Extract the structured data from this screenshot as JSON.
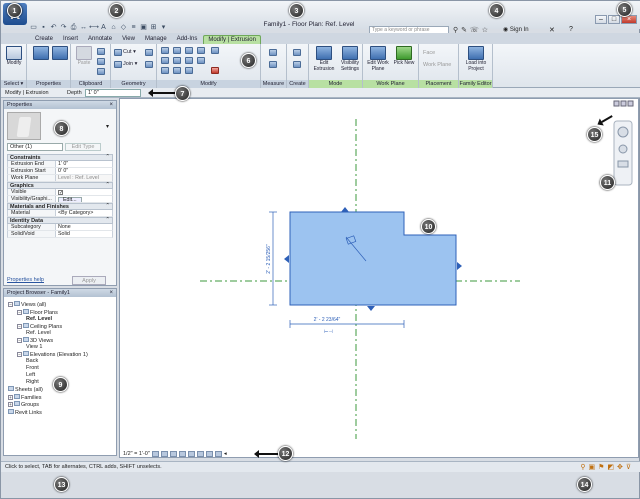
{
  "window": {
    "title": "Family1 - Floor Plan: Ref. Level",
    "search_placeholder": "Type a keyword or phrase",
    "signin": "Sign In",
    "app_letter": "R"
  },
  "tabs": [
    "Create",
    "Insert",
    "Annotate",
    "View",
    "Manage",
    "Add-Ins",
    "Modify | Extrusion"
  ],
  "ribbon": {
    "panels": [
      "Select ▾",
      "Properties",
      "Clipboard",
      "Geometry",
      "Modify",
      "Measure",
      "Create",
      "Mode",
      "Work Plane",
      "Placement",
      "Family Editor"
    ],
    "modify_label": "Modify",
    "paste_label": "Paste",
    "cut_label": "Cut ▾",
    "join_label": "Join ▾",
    "mode_buttons": [
      "Edit Extrusion",
      "Visibility Settings"
    ],
    "workplane_buttons": [
      "Edit Work Plane",
      "Pick New"
    ],
    "placement": [
      "Face",
      "Work Plane"
    ],
    "load_label": "Load into Project"
  },
  "options_bar": {
    "mode": "Modify | Extrusion",
    "depth_label": "Depth",
    "depth_value": "1'  0\""
  },
  "properties": {
    "title": "Properties",
    "type_selector": "Other (1)",
    "edit_type": "Edit Type",
    "groups": [
      {
        "name": "Constraints",
        "rows": [
          [
            "Extrusion End",
            "1'  0\""
          ],
          [
            "Extrusion Start",
            "0'  0\""
          ],
          [
            "Work Plane",
            "Level : Ref. Level"
          ]
        ]
      },
      {
        "name": "Graphics",
        "rows": [
          [
            "Visible",
            "✓"
          ],
          [
            "Visibility/Graphi...",
            "Edit..."
          ]
        ]
      },
      {
        "name": "Materials and Finishes",
        "rows": [
          [
            "Material",
            "<By Category>"
          ]
        ]
      },
      {
        "name": "Identity Data",
        "rows": [
          [
            "Subcategory",
            "None"
          ],
          [
            "Solid/Void",
            "Solid"
          ]
        ]
      }
    ],
    "help": "Properties help",
    "apply": "Apply"
  },
  "browser": {
    "title": "Project Browser - Family1",
    "items": [
      {
        "label": "Views (all)",
        "level": 0,
        "exp": "−"
      },
      {
        "label": "Floor Plans",
        "level": 1,
        "exp": "−"
      },
      {
        "label": "Ref. Level",
        "level": 2,
        "bold": true
      },
      {
        "label": "Ceiling Plans",
        "level": 1,
        "exp": "−"
      },
      {
        "label": "Ref. Level",
        "level": 2
      },
      {
        "label": "3D Views",
        "level": 1,
        "exp": "−"
      },
      {
        "label": "View 1",
        "level": 2
      },
      {
        "label": "Elevations (Elevation 1)",
        "level": 1,
        "exp": "−"
      },
      {
        "label": "Back",
        "level": 2
      },
      {
        "label": "Front",
        "level": 2
      },
      {
        "label": "Left",
        "level": 2
      },
      {
        "label": "Right",
        "level": 2
      },
      {
        "label": "Sheets (all)",
        "level": 0
      },
      {
        "label": "Families",
        "level": 0,
        "exp": "+"
      },
      {
        "label": "Groups",
        "level": 0,
        "exp": "+"
      },
      {
        "label": "Revit Links",
        "level": 0
      }
    ]
  },
  "canvas": {
    "dim_horizontal": "2' - 2 23/64\"",
    "dim_vertical": "2' - 2 15/256\""
  },
  "view_control": {
    "scale": "1/2\" = 1'-0\""
  },
  "status": {
    "text": "Click to select, TAB for alternates, CTRL adds, SHIFT unselects."
  },
  "callouts": [
    "1",
    "2",
    "3",
    "4",
    "5",
    "6",
    "7",
    "8",
    "9",
    "10",
    "11",
    "12",
    "13",
    "14",
    "15"
  ],
  "colors": {
    "shape_fill": "#9cc3f0",
    "shape_stroke": "#2e60b8",
    "ref_plane": "#3c9a3c",
    "context_tab": "#b8e0a2"
  }
}
